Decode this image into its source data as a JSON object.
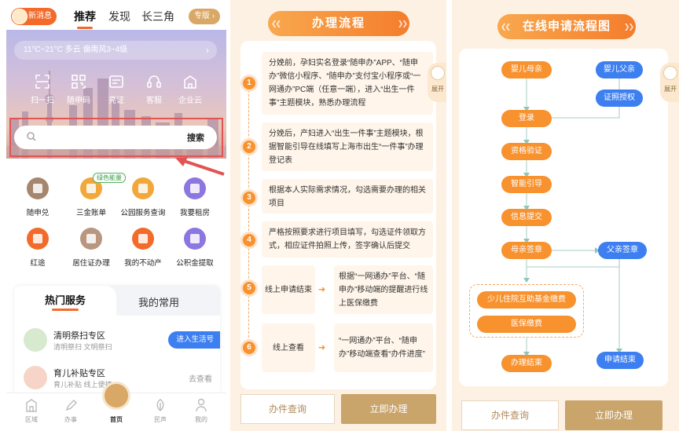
{
  "panel1": {
    "top": {
      "message_badge": "新消息",
      "tabs": [
        "推荐",
        "发现",
        "长三角"
      ],
      "pro_pill": "专版 ›"
    },
    "weather": "11°C~21°C 多云 偏南风3~4级",
    "weather_chevron": "›",
    "quick_actions": [
      "扫一扫",
      "随申码",
      "亮证",
      "客服",
      "企业云"
    ],
    "search": {
      "button": "搜索"
    },
    "green_tag": "绿色能量",
    "services": [
      "随申兑",
      "三金账单",
      "公园服务查询",
      "我要租房",
      "红途",
      "居住证办理",
      "我的不动产",
      "公积金提取"
    ],
    "hot": {
      "tabs": [
        "热门服务",
        "我的常用"
      ],
      "rows": [
        {
          "title": "清明祭扫专区",
          "sub": "清明祭扫 文明祭扫",
          "action": "进入生活号"
        },
        {
          "title": "育儿补贴专区",
          "sub": "育儿补贴 线上便捷",
          "action": "去查看"
        }
      ]
    },
    "tabbar": [
      "区域",
      "办事",
      "首页",
      "民声",
      "我的"
    ]
  },
  "panel2": {
    "title": "办理流程",
    "expand": "展开",
    "steps": [
      {
        "n": "1",
        "text": "分娩前，孕妇实名登录“随申办”APP、“随申办”微信小程序、“随申办”支付宝小程序或“一网通办”PC端（任意一端），进入“出生一件事”主题模块，熟悉办理流程"
      },
      {
        "n": "2",
        "text": "分娩后，产妇进入“出生一件事”主题模块，根据智能引导在线填写上海市出生“一件事”办理登记表"
      },
      {
        "n": "3",
        "text": "根据本人实际需求情况，勾选需要办理的相关项目"
      },
      {
        "n": "4",
        "text": "严格按照要求进行项目填写，勾选证件领取方式，相应证件拍照上传，签字确认后提交"
      },
      {
        "n": "5",
        "left": "线上申请结束",
        "arrow": "➜",
        "right": "根据“一网通办”平台、“随申办”移动端的提醒进行线上医保缴费"
      },
      {
        "n": "6",
        "left": "线上查看",
        "arrow": "➜",
        "right": "“一网通办”平台、“随申办”移动端查看“办件进度”"
      }
    ],
    "btn_query": "办件查询",
    "btn_apply": "立即办理"
  },
  "panel3": {
    "title": "在线申请流程图",
    "expand": "展开",
    "nodes": {
      "mother": "婴儿母亲",
      "father": "婴儿父亲",
      "auth": "证照授权",
      "login": "登录",
      "verify": "资格验证",
      "guide": "智能引导",
      "submit": "信息提交",
      "mother_sign": "母亲签章",
      "father_sign": "父亲签章",
      "fund": "少儿住院互助基金缴费",
      "medical": "医保缴费",
      "handle_end": "办理结束",
      "apply_end": "申请结束"
    },
    "btn_query": "办件查询",
    "btn_apply": "立即办理"
  },
  "colors": {
    "orange": "#f7922f",
    "blue": "#3d7ff0",
    "gold": "#c9a46b",
    "cream": "#fdf1e3",
    "annotation_red": "#e25454"
  }
}
